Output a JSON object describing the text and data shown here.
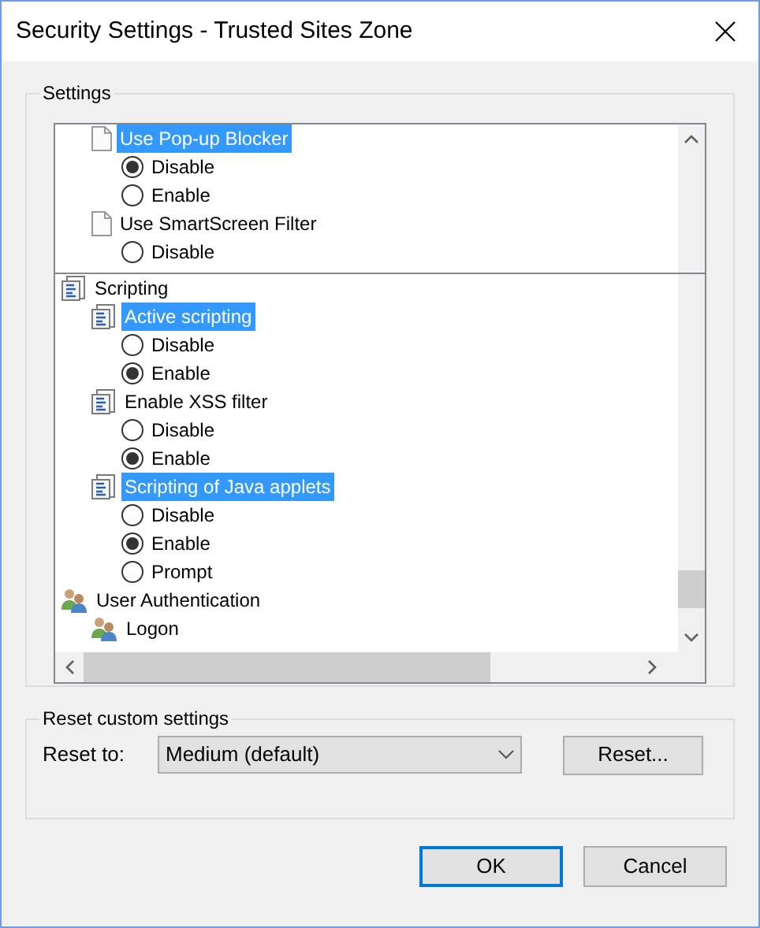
{
  "window": {
    "title": "Security Settings - Trusted Sites Zone"
  },
  "settings": {
    "label": "Settings",
    "upper_pane": [
      {
        "kind": "document",
        "label": "Use Pop-up Blocker",
        "selected": true,
        "children": [
          {
            "kind": "option",
            "label": "Disable",
            "selected": true
          },
          {
            "kind": "option",
            "label": "Enable",
            "selected": false
          }
        ]
      },
      {
        "kind": "document",
        "label": "Use SmartScreen Filter",
        "selected": false,
        "children": [
          {
            "kind": "option",
            "label": "Disable",
            "selected": false
          }
        ]
      }
    ],
    "lower_pane": [
      {
        "kind": "script",
        "label": "Scripting",
        "selected": false,
        "children": [
          {
            "kind": "script",
            "label": "Active scripting",
            "selected": true,
            "children": [
              {
                "kind": "option",
                "label": "Disable",
                "selected": false
              },
              {
                "kind": "option",
                "label": "Enable",
                "selected": true
              }
            ]
          },
          {
            "kind": "script",
            "label": "Enable XSS filter",
            "selected": false,
            "children": [
              {
                "kind": "option",
                "label": "Disable",
                "selected": false
              },
              {
                "kind": "option",
                "label": "Enable",
                "selected": true
              }
            ]
          },
          {
            "kind": "script",
            "label": "Scripting of Java applets",
            "selected": true,
            "children": [
              {
                "kind": "option",
                "label": "Disable",
                "selected": false
              },
              {
                "kind": "option",
                "label": "Enable",
                "selected": true
              },
              {
                "kind": "option",
                "label": "Prompt",
                "selected": false
              }
            ]
          }
        ]
      },
      {
        "kind": "users",
        "label": "User Authentication",
        "selected": false,
        "children": [
          {
            "kind": "users",
            "label": "Logon",
            "selected": false
          }
        ]
      }
    ]
  },
  "reset": {
    "label": "Reset custom settings",
    "field_label": "Reset to:",
    "value": "Medium (default)",
    "button": "Reset..."
  },
  "buttons": [
    {
      "label": "OK",
      "default": true
    },
    {
      "label": "Cancel",
      "default": false
    }
  ]
}
